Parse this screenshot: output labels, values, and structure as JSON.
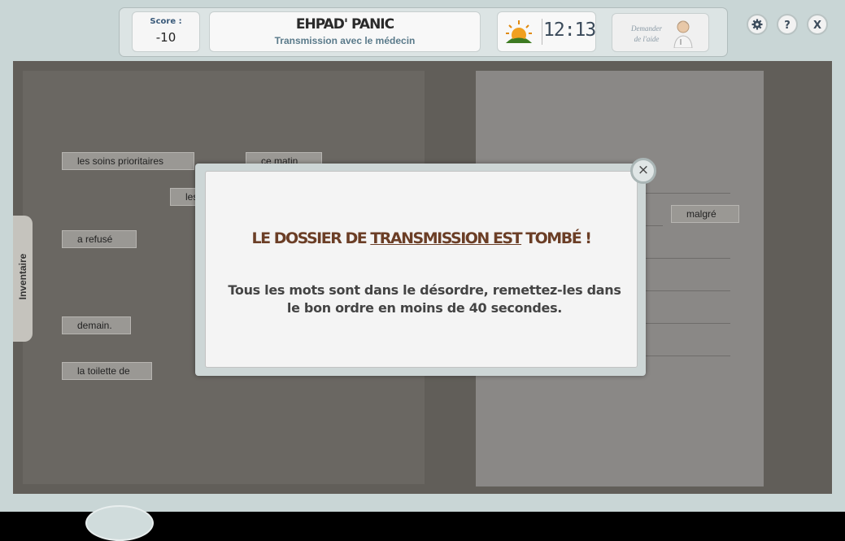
{
  "header": {
    "score_label": "Score :",
    "score_value": "-10",
    "game_title": "EHPAD' PANIC",
    "subtitle": "Transmission avec le médecin",
    "time": "12:13",
    "help_label_line1": "Demander",
    "help_label_line2": "de l'aide",
    "settings_icon": "gear-icon",
    "help_button": "?",
    "close_button": "X"
  },
  "sidebar": {
    "inventory_label": "Inventaire"
  },
  "words": [
    "les soins prioritaires",
    "ce matin",
    "les",
    "a refusé",
    "demain.",
    "la toilette de",
    "malgré"
  ],
  "modal": {
    "title_part1": "LE DOSSIER DE ",
    "title_part2": "TRANSMISSION EST",
    "title_part3": " TOMBÉ !",
    "message": "Tous les mots sont dans le désordre, remettez-les dans le bon ordre en moins de 40 secondes.",
    "close_symbol": "×"
  },
  "colors": {
    "modal_title": "#6b3e26",
    "board": "#615e59"
  }
}
